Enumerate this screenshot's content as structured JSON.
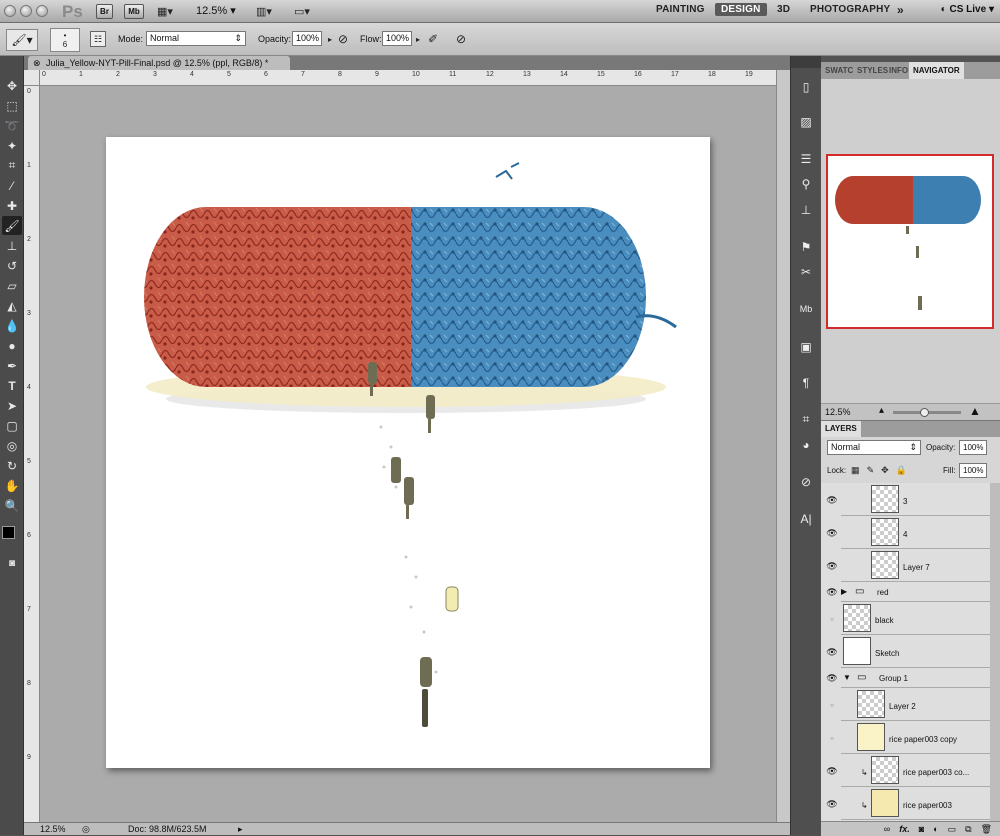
{
  "menubar": {
    "app_logo": "Ps",
    "br_label": "Br",
    "mb_label": "Mb",
    "zoom": "12.5%",
    "workspaces": [
      "PAINTING",
      "DESIGN",
      "3D",
      "PHOTOGRAPHY"
    ],
    "active_workspace": "DESIGN",
    "more": "»",
    "cs_live": "CS Live"
  },
  "options": {
    "brush_size": "6",
    "mode_label": "Mode:",
    "mode_value": "Normal",
    "opacity_label": "Opacity:",
    "opacity_value": "100%",
    "flow_label": "Flow:",
    "flow_value": "100%"
  },
  "document": {
    "tab_title": "Julia_Yellow-NYT-Pill-Final.psd @ 12.5% (ppl, RGB/8) *",
    "status_zoom": "12.5%",
    "doc_size": "Doc: 98.8M/623.5M"
  },
  "rulers": {
    "h": [
      "0",
      "1",
      "2",
      "3",
      "4",
      "5",
      "6",
      "7",
      "8",
      "9",
      "10",
      "11",
      "12",
      "13",
      "14",
      "15",
      "16",
      "17",
      "18",
      "19"
    ],
    "v": [
      "0",
      "1",
      "2",
      "3",
      "4",
      "5",
      "6",
      "7",
      "8",
      "9",
      "0"
    ]
  },
  "navigator": {
    "tabs": [
      "SWATC",
      "STYLES",
      "INFO",
      "NAVIGATOR"
    ],
    "active_tab": "NAVIGATOR",
    "zoom": "12.5%",
    "zoom_fraction": 0.45
  },
  "layers": {
    "panel_title": "LAYERS",
    "blend_mode": "Normal",
    "opacity_label": "Opacity:",
    "opacity_value": "100%",
    "lock_label": "Lock:",
    "fill_label": "Fill:",
    "fill_value": "100%",
    "items": [
      {
        "name": "3",
        "visible": true
      },
      {
        "name": "4",
        "visible": true
      },
      {
        "name": "Layer 7",
        "visible": true
      },
      {
        "name": "red",
        "visible": true
      },
      {
        "name": "black",
        "visible": false
      },
      {
        "name": "Sketch",
        "visible": true
      },
      {
        "name": "Group 1",
        "visible": true
      },
      {
        "name": "Layer 2",
        "visible": false
      },
      {
        "name": "rice paper003 copy",
        "visible": false
      },
      {
        "name": "rice paper003 co...",
        "visible": true
      },
      {
        "name": "rice paper003",
        "visible": true
      }
    ],
    "bottom_fx": "fx."
  },
  "colors": {
    "accent_red": "#d42a2a",
    "pill_red": "#b5402e",
    "pill_blue": "#3d7fb0",
    "paper_yellow": "#fbf3c8"
  }
}
